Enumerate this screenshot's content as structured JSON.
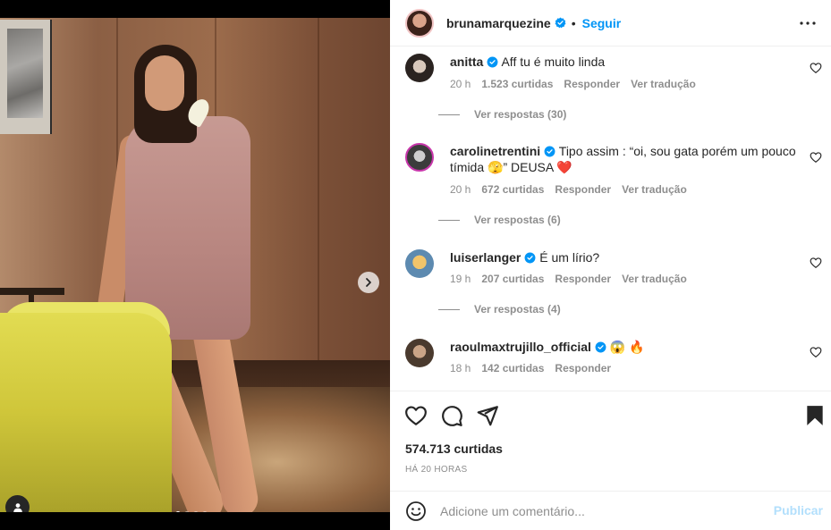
{
  "colors": {
    "accent": "#0095f6",
    "text": "#262626",
    "muted": "#8e8e8e",
    "heart_red": "#ed4956",
    "publish_disabled": "#b2dffc"
  },
  "post": {
    "author": "bruna",
    "author_username": "brunamarquezine",
    "separator": "•",
    "follow_label": "Seguir",
    "likes": "574.713 curtidas",
    "time_ago": "HÁ 20 HORAS",
    "carousel": {
      "total": 4,
      "current": 1
    }
  },
  "comments": [
    {
      "username": "anitta",
      "verified": true,
      "text": "Aff tu é muito linda",
      "time": "20 h",
      "likes": "1.523 curtidas",
      "reply_label": "Responder",
      "translate_label": "Ver tradução",
      "replies_label": "Ver respostas (30)"
    },
    {
      "username": "carolinetrentini",
      "verified": true,
      "text": "Tipo assim : “oi, sou gata porém um pouco tímida 🫣” DEUSA",
      "emoji_suffix": "❤️",
      "time": "20 h",
      "likes": "672 curtidas",
      "reply_label": "Responder",
      "translate_label": "Ver tradução",
      "replies_label": "Ver respostas (6)"
    },
    {
      "username": "luiserlanger",
      "verified": true,
      "text": "É um lírio?",
      "time": "19 h",
      "likes": "207 curtidas",
      "reply_label": "Responder",
      "translate_label": "Ver tradução",
      "replies_label": "Ver respostas (4)"
    },
    {
      "username": "raoulmaxtrujillo_official",
      "verified": true,
      "text": "😱 🔥",
      "time": "18 h",
      "likes": "142 curtidas",
      "reply_label": "Responder"
    }
  ],
  "compose": {
    "placeholder": "Adicione um comentário...",
    "publish_label": "Publicar"
  },
  "icons": {
    "like": "heart-icon",
    "comment": "comment-icon",
    "share": "send-icon",
    "save": "bookmark-icon",
    "more": "more-icon",
    "emoji": "emoji-icon",
    "next": "chevron-right-icon",
    "tag": "user-tag-icon",
    "verified": "verified-badge-icon"
  }
}
